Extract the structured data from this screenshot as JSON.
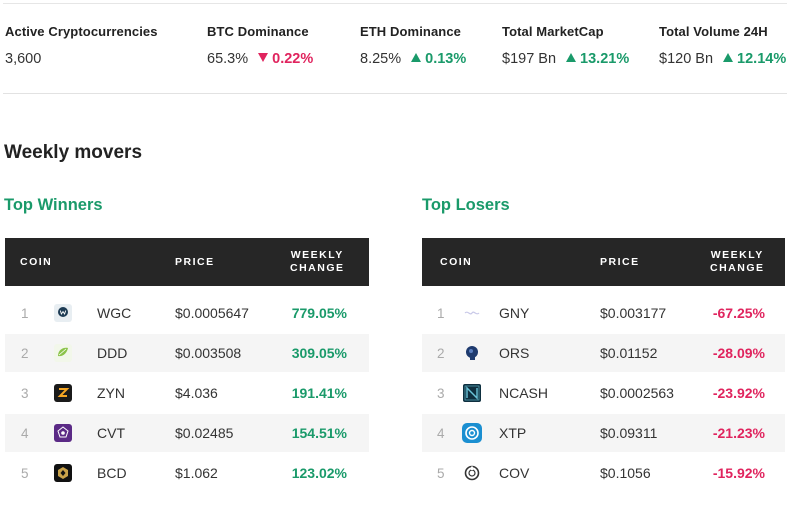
{
  "stats": [
    {
      "label": "Active Cryptocurrencies",
      "value": "3,600",
      "change": "",
      "direction": ""
    },
    {
      "label": "BTC Dominance",
      "value": "65.3%",
      "change": "0.22%",
      "direction": "down"
    },
    {
      "label": "ETH Dominance",
      "value": "8.25%",
      "change": "0.13%",
      "direction": "up"
    },
    {
      "label": "Total MarketCap",
      "value": "$197 Bn",
      "change": "13.21%",
      "direction": "up"
    },
    {
      "label": "Total Volume 24H",
      "value": "$120 Bn",
      "change": "12.14%",
      "direction": "up"
    }
  ],
  "section_title": "Weekly movers",
  "winners": {
    "title": "Top Winners",
    "headers": {
      "coin": "COIN",
      "price": "PRICE",
      "change_line1": "WEEKLY",
      "change_line2": "CHANGE"
    },
    "rows": [
      {
        "rank": "1",
        "symbol": "WGC",
        "price": "$0.0005647",
        "change": "779.05%",
        "icon": "wgc-icon"
      },
      {
        "rank": "2",
        "symbol": "DDD",
        "price": "$0.003508",
        "change": "309.05%",
        "icon": "ddd-icon"
      },
      {
        "rank": "3",
        "symbol": "ZYN",
        "price": "$4.036",
        "change": "191.41%",
        "icon": "zyn-icon"
      },
      {
        "rank": "4",
        "symbol": "CVT",
        "price": "$0.02485",
        "change": "154.51%",
        "icon": "cvt-icon"
      },
      {
        "rank": "5",
        "symbol": "BCD",
        "price": "$1.062",
        "change": "123.02%",
        "icon": "bcd-icon"
      }
    ]
  },
  "losers": {
    "title": "Top Losers",
    "headers": {
      "coin": "COIN",
      "price": "PRICE",
      "change_line1": "WEEKLY",
      "change_line2": "CHANGE"
    },
    "rows": [
      {
        "rank": "1",
        "symbol": "GNY",
        "price": "$0.003177",
        "change": "-67.25%",
        "icon": "gny-icon"
      },
      {
        "rank": "2",
        "symbol": "ORS",
        "price": "$0.01152",
        "change": "-28.09%",
        "icon": "ors-icon"
      },
      {
        "rank": "3",
        "symbol": "NCASH",
        "price": "$0.0002563",
        "change": "-23.92%",
        "icon": "ncash-icon"
      },
      {
        "rank": "4",
        "symbol": "XTP",
        "price": "$0.09311",
        "change": "-21.23%",
        "icon": "xtp-icon"
      },
      {
        "rank": "5",
        "symbol": "COV",
        "price": "$0.1056",
        "change": "-15.92%",
        "icon": "cov-icon"
      }
    ]
  },
  "colors": {
    "up": "#1a9a6a",
    "down": "#e0245e",
    "header_bg": "#262626"
  }
}
